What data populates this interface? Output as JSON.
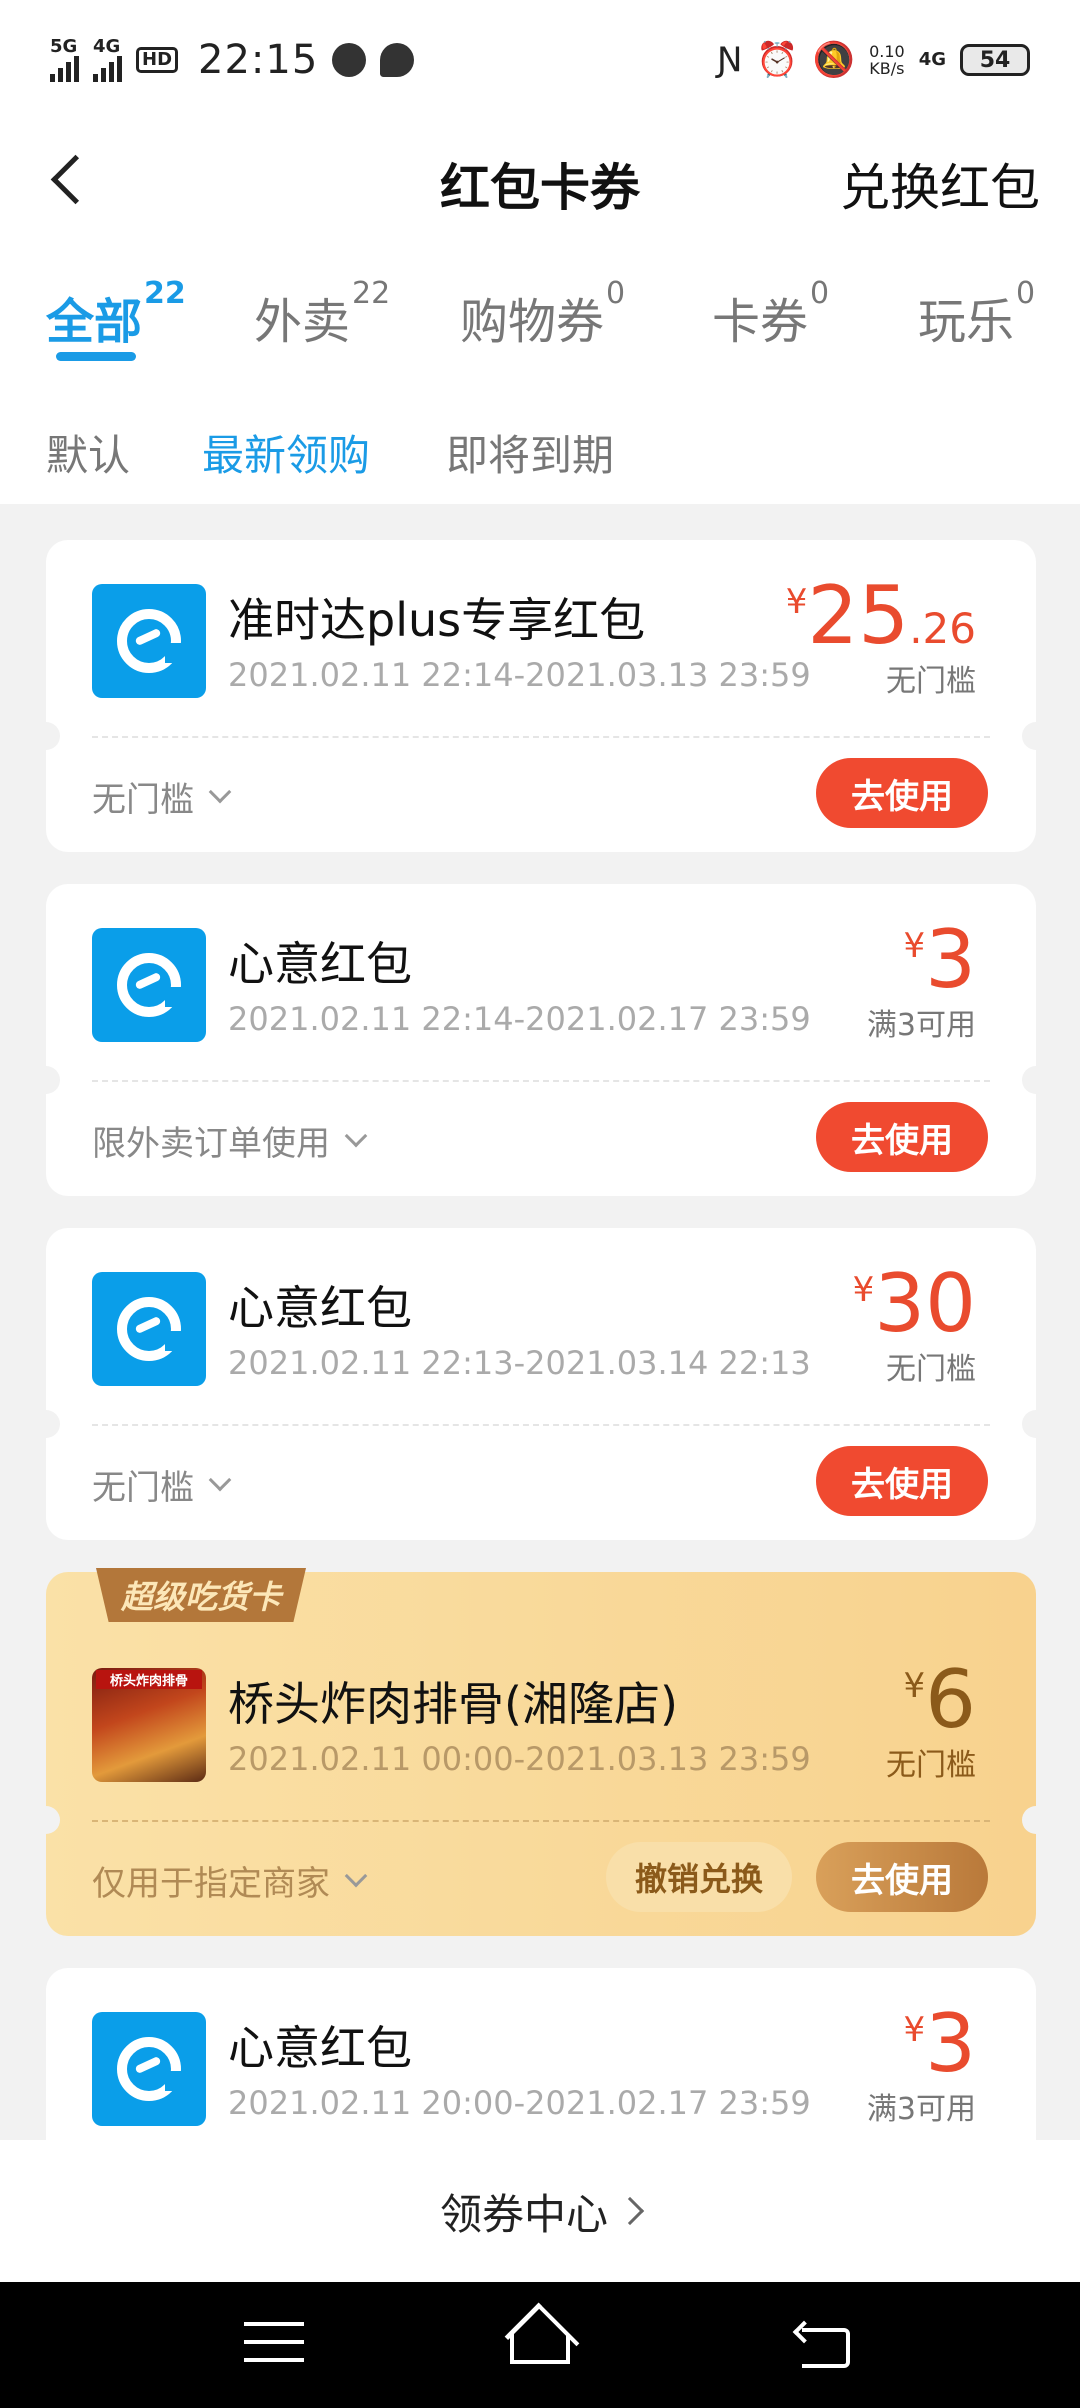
{
  "status_bar": {
    "signal1": "5G",
    "signal2": "4G",
    "hd": "HD",
    "time": "22:15",
    "net_speed_value": "0.10",
    "net_speed_unit": "KB/s",
    "net_type": "4G",
    "battery": "54"
  },
  "header": {
    "title": "红包卡券",
    "exchange_label": "兑换红包"
  },
  "tabs": [
    {
      "label": "全部",
      "count": "22"
    },
    {
      "label": "外卖",
      "count": "22"
    },
    {
      "label": "购物券",
      "count": "0"
    },
    {
      "label": "卡券",
      "count": "0"
    },
    {
      "label": "玩乐",
      "count": "0"
    }
  ],
  "sort": [
    "默认",
    "最新领购",
    "即将到期"
  ],
  "coupons": [
    {
      "name": "准时达plus专享红包",
      "date": "2021.02.11 22:14-2021.03.13 23:59",
      "currency": "¥",
      "amount": "25",
      "decimal": ".26",
      "condition": "无门槛",
      "limit": "无门槛",
      "use_label": "去使用"
    },
    {
      "name": "心意红包",
      "date": "2021.02.11 22:14-2021.02.17 23:59",
      "currency": "¥",
      "amount": "3",
      "condition": "满3可用",
      "limit": "限外卖订单使用",
      "use_label": "去使用"
    },
    {
      "name": "心意红包",
      "date": "2021.02.11 22:13-2021.03.14 22:13",
      "currency": "¥",
      "amount": "30",
      "condition": "无门槛",
      "limit": "无门槛",
      "use_label": "去使用"
    },
    {
      "tag": "超级吃货卡",
      "shop_logo_text": "桥头炸肉排骨",
      "name": "桥头炸肉排骨(湘隆店)",
      "date": "2021.02.11 00:00-2021.03.13 23:59",
      "currency": "¥",
      "amount": "6",
      "condition": "无门槛",
      "limit": "仅用于指定商家",
      "revoke_label": "撤销兑换",
      "use_label": "去使用"
    },
    {
      "name": "心意红包",
      "date": "2021.02.11 20:00-2021.02.17 23:59",
      "currency": "¥",
      "amount": "3",
      "condition": "满3可用"
    }
  ],
  "footer": {
    "coupon_center": "领券中心"
  },
  "colors": {
    "accent": "#1a9be6",
    "price": "#e94b2e",
    "use_button": "#f04a30",
    "gold_card": "#f8d28e"
  }
}
